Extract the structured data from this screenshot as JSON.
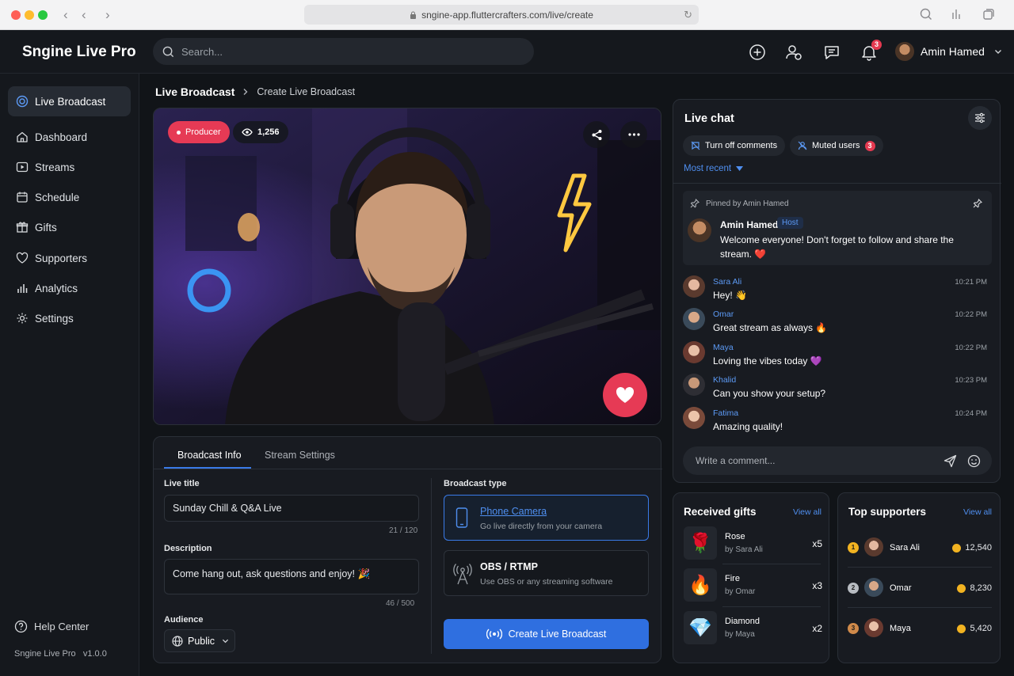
{
  "browser": {
    "url": "sngine-app.fluttercrafters.com/live/create"
  },
  "header": {
    "brand": "Sngine Live Pro",
    "search_placeholder": "Search...",
    "notification_count": "3",
    "user_name": "Amin Hamed"
  },
  "sidebar": {
    "items": [
      {
        "label": "Live Broadcast",
        "icon": "live-icon",
        "active": true
      },
      {
        "label": "Dashboard",
        "icon": "home-icon"
      },
      {
        "label": "Streams",
        "icon": "play-icon"
      },
      {
        "label": "Schedule",
        "icon": "calendar-icon"
      },
      {
        "label": "Gifts",
        "icon": "gift-icon"
      },
      {
        "label": "Supporters",
        "icon": "heart-icon"
      },
      {
        "label": "Analytics",
        "icon": "bar-chart-icon"
      },
      {
        "label": "Settings",
        "icon": "gear-icon"
      }
    ],
    "help": "Help Center",
    "app_name": "Sngine Live Pro",
    "version": "v1.0.0"
  },
  "breadcrumb": {
    "parent": "Live Broadcast",
    "current": "Create Live Broadcast"
  },
  "video": {
    "role_badge": "Producer",
    "viewers": "1,256"
  },
  "form": {
    "tabs": [
      "Broadcast Info",
      "Stream Settings"
    ],
    "live_title_label": "Live title",
    "live_title_value": "Sunday Chill & Q&A Live",
    "live_title_count": "21 / 120",
    "description_label": "Description",
    "description_value": "Come hang out, ask questions and enjoy! 🎉",
    "description_count": "46 / 500",
    "audience_label": "Audience",
    "audience_value": "Public",
    "broadcast_type_label": "Broadcast type",
    "types": [
      {
        "title": "Phone Camera",
        "desc": "Go live directly from your camera",
        "selected": true
      },
      {
        "title": "OBS / RTMP",
        "desc": "Use OBS or any streaming software",
        "selected": false
      }
    ],
    "create_button": "Create Live Broadcast"
  },
  "chat": {
    "title": "Live chat",
    "turn_off": "Turn off comments",
    "muted": "Muted users",
    "muted_count": "3",
    "sort": "Most recent",
    "pinned_by": "Pinned by Amin Hamed",
    "pinned_name": "Amin Hamed",
    "pinned_role": "Host",
    "pinned_text_1": "Welcome everyone! Don't forget to follow and share the",
    "pinned_text_2": "stream. ❤️",
    "messages": [
      {
        "name": "Sara Ali",
        "text": "Hey! 👋",
        "time": "10:21 PM"
      },
      {
        "name": "Omar",
        "text": "Great stream as always 🔥",
        "time": "10:22 PM"
      },
      {
        "name": "Maya",
        "text": "Loving the vibes today 💜",
        "time": "10:22 PM"
      },
      {
        "name": "Khalid",
        "text": "Can you show your setup?",
        "time": "10:23 PM"
      },
      {
        "name": "Fatima",
        "text": "Amazing quality!",
        "time": "10:24 PM"
      }
    ],
    "comment_placeholder": "Write a comment..."
  },
  "gifts": {
    "title": "Received gifts",
    "view_all": "View all",
    "items": [
      {
        "name": "Rose",
        "by": "by Sara Ali",
        "qty": "x5",
        "icon": "🌹"
      },
      {
        "name": "Fire",
        "by": "by Omar",
        "qty": "x3",
        "icon": "🔥"
      },
      {
        "name": "Diamond",
        "by": "by Maya",
        "qty": "x2",
        "icon": "💎"
      }
    ]
  },
  "supporters": {
    "title": "Top supporters",
    "view_all": "View all",
    "items": [
      {
        "rank": "1",
        "name": "Sara Ali",
        "score": "12,540"
      },
      {
        "rank": "2",
        "name": "Omar",
        "score": "8,230"
      },
      {
        "rank": "3",
        "name": "Maya",
        "score": "5,420"
      }
    ]
  }
}
